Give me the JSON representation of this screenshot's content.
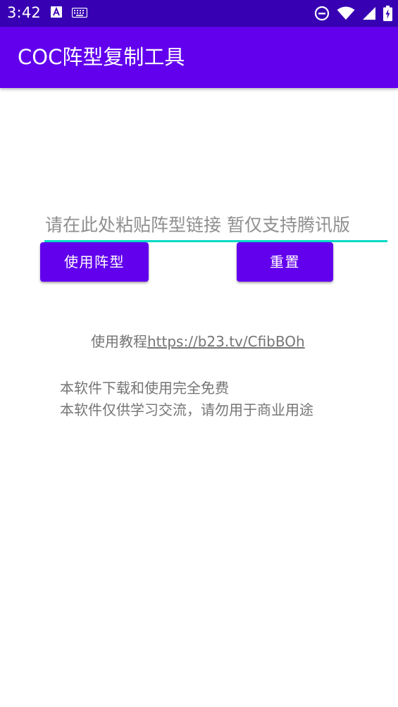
{
  "status_bar": {
    "time": "3:42",
    "left_icons": [
      "a-notification-icon",
      "keyboard-icon"
    ],
    "right_icons": [
      "do-not-disturb-icon",
      "wifi-icon",
      "cell-signal-icon",
      "battery-icon"
    ]
  },
  "app_bar": {
    "title": "COC阵型复制工具"
  },
  "form": {
    "input_placeholder": "请在此处粘贴阵型链接 暂仅支持腾讯版",
    "input_value": "",
    "use_button_label": "使用阵型",
    "reset_button_label": "重置"
  },
  "tutorial": {
    "prefix": "使用教程",
    "link_text": "https://b23.tv/CfibBOh"
  },
  "notice": {
    "line1": "本软件下载和使用完全免费",
    "line2": "本软件仅供学习交流，请勿用于商业用途"
  },
  "colors": {
    "status_bar": "#3700b3",
    "primary": "#6200ee",
    "accent": "#03dac5",
    "secondary_text": "#757575"
  }
}
